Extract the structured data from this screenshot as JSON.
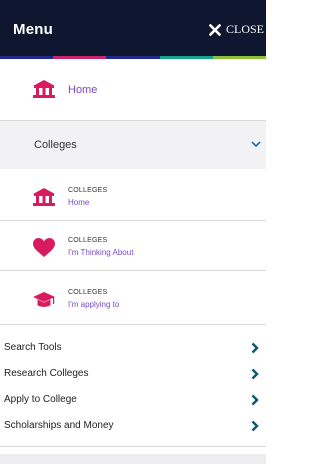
{
  "header": {
    "title": "Menu",
    "close_label": "CLOSE"
  },
  "colors": {
    "header_bg": "#0f1730",
    "stripe": [
      "#1f2a88",
      "#c9256b",
      "#1f2a88",
      "#17a58a",
      "#8cbf3a"
    ],
    "accent_pink": "#d81b60",
    "link_purple": "#7a4bc7",
    "chevron_blue": "#1a6fa8",
    "arrow_teal": "#0b5a6e"
  },
  "home": {
    "label": "Home",
    "icon": "school-building-icon"
  },
  "colleges_section": {
    "label": "Colleges",
    "expanded": true
  },
  "college_items": [
    {
      "category": "COLLEGES",
      "label": "Home",
      "icon": "school-building-icon"
    },
    {
      "category": "COLLEGES",
      "label": "I'm Thinking About",
      "icon": "heart-icon"
    },
    {
      "category": "COLLEGES",
      "label": "I'm applying to",
      "icon": "graduation-cap-icon"
    }
  ],
  "links": [
    {
      "label": "Search Tools"
    },
    {
      "label": "Research Colleges"
    },
    {
      "label": "Apply to College"
    },
    {
      "label": "Scholarships and Money"
    }
  ]
}
